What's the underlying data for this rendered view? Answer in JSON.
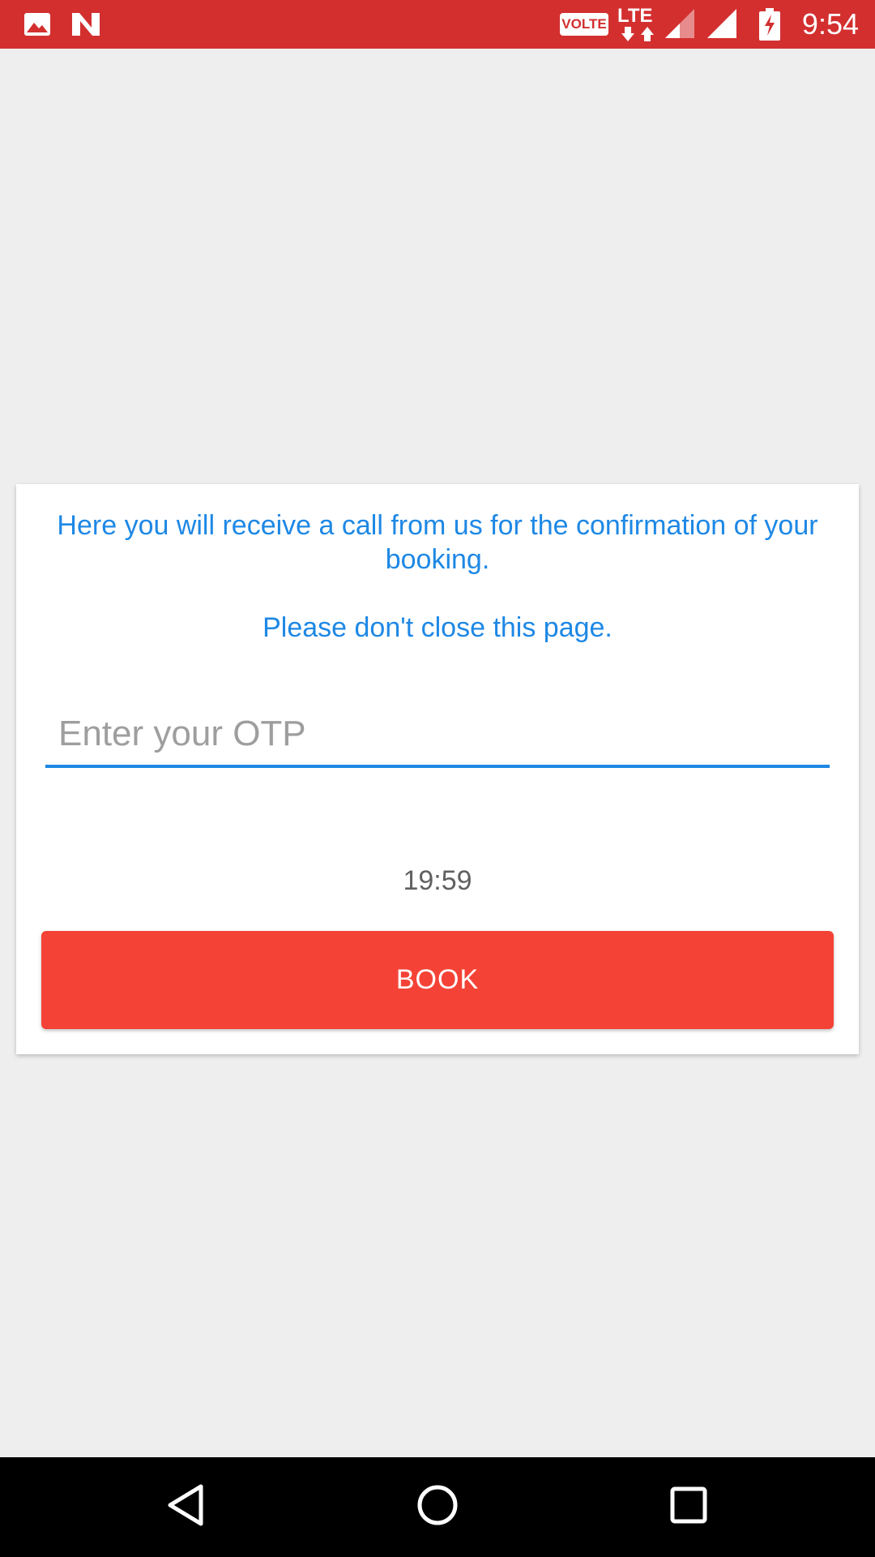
{
  "status_bar": {
    "time": "9:54",
    "volte_label": "VOLTE",
    "network_label": "LTE",
    "icons": [
      "gallery-icon",
      "n-app-icon",
      "signal-icon",
      "battery-charging-icon"
    ],
    "background_color": "#d32f2f"
  },
  "card": {
    "message": "Here you will receive a call from us for the confirmation of your booking.",
    "notice": "Please don't close this page.",
    "otp_placeholder": "Enter your OTP",
    "otp_value": "",
    "timer": "19:59",
    "book_label": "BOOK",
    "accent_color": "#1e88e5",
    "button_color": "#f44336"
  },
  "nav_bar": {
    "icons": [
      "back-icon",
      "home-icon",
      "recents-icon"
    ]
  }
}
